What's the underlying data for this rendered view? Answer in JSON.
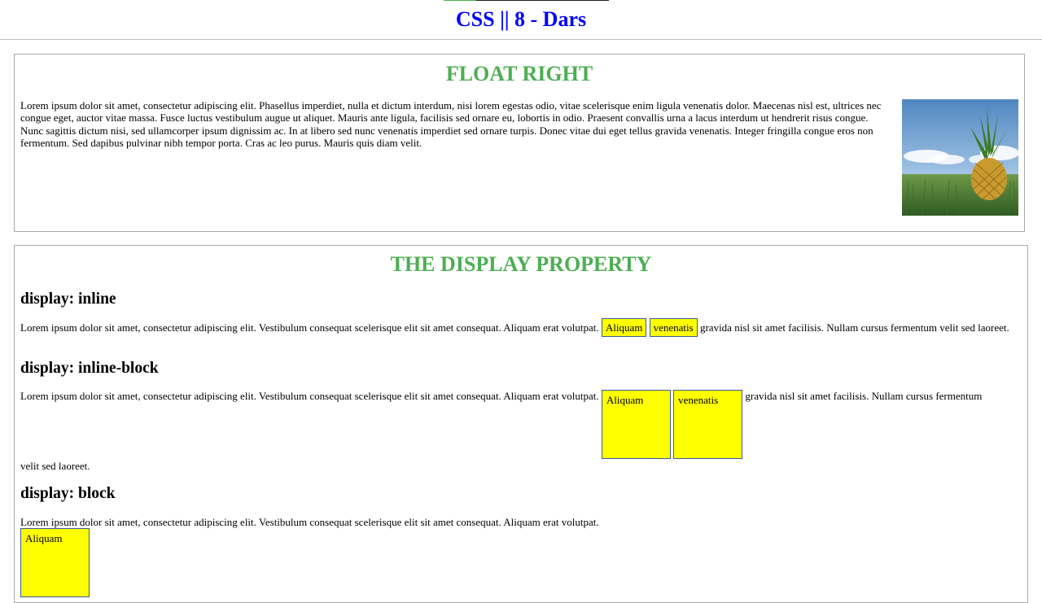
{
  "header": {
    "title": "CSS || 8 - Dars"
  },
  "float_section": {
    "title": "FLOAT RIGHT",
    "image_alt": "pineapple-in-field",
    "text": "Lorem ipsum dolor sit amet, consectetur adipiscing elit. Phasellus imperdiet, nulla et dictum interdum, nisi lorem egestas odio, vitae scelerisque enim ligula venenatis dolor. Maecenas nisl est, ultrices nec congue eget, auctor vitae massa. Fusce luctus vestibulum augue ut aliquet. Mauris ante ligula, facilisis sed ornare eu, lobortis in odio. Praesent convallis urna a lacus interdum ut hendrerit risus congue. Nunc sagittis dictum nisi, sed ullamcorper ipsum dignissim ac. In at libero sed nunc venenatis imperdiet sed ornare turpis. Donec vitae dui eget tellus gravida venenatis. Integer fringilla congue eros non fermentum. Sed dapibus pulvinar nibh tempor porta. Cras ac leo purus. Mauris quis diam velit."
  },
  "display_section": {
    "title": "THE DISPLAY PROPERTY",
    "inline": {
      "heading": "display: inline",
      "text_before": "Lorem ipsum dolor sit amet, consectetur adipiscing elit. Vestibulum consequat scelerisque elit sit amet consequat. Aliquam erat volutpat.",
      "box1": "Aliquam",
      "box2": "venenatis",
      "text_after": "gravida nisl sit amet facilisis. Nullam cursus fermentum velit sed laoreet."
    },
    "inline_block": {
      "heading": "display: inline-block",
      "text_before": "Lorem ipsum dolor sit amet, consectetur adipiscing elit. Vestibulum consequat scelerisque elit sit amet consequat. Aliquam erat volutpat.",
      "box1": "Aliquam",
      "box2": "venenatis",
      "text_after": "gravida nisl sit amet facilisis. Nullam cursus fermentum",
      "text_wrap": "velit sed laoreet."
    },
    "block": {
      "heading": "display: block",
      "text_before": "Lorem ipsum dolor sit amet, consectetur adipiscing elit. Vestibulum consequat scelerisque elit sit amet consequat. Aliquam erat volutpat.",
      "box1": "Aliquam"
    }
  },
  "colors": {
    "header_title": "#0000ff",
    "section_title": "#4caf50",
    "box_fill": "#ffff00",
    "box_border": "#3a5aa0"
  }
}
